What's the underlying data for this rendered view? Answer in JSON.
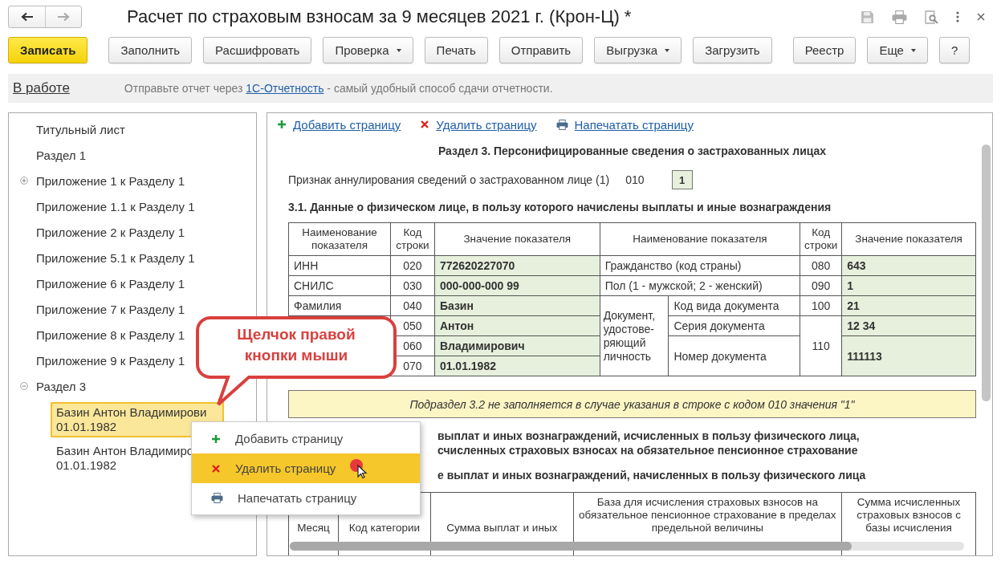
{
  "window": {
    "title": "Расчет по страховым взносам за 9 месяцев 2021 г. (Крон-Ц) *"
  },
  "toolbar": [
    {
      "label": "Записать",
      "kind": "primary"
    },
    {
      "label": "Заполнить",
      "kind": "plain"
    },
    {
      "label": "Расшифровать",
      "kind": "plain"
    },
    {
      "label": "Проверка",
      "kind": "dropdown"
    },
    {
      "label": "Печать",
      "kind": "plain"
    },
    {
      "label": "Отправить",
      "kind": "plain"
    },
    {
      "label": "Выгрузка",
      "kind": "dropdown"
    },
    {
      "label": "Загрузить",
      "kind": "plain"
    },
    {
      "label": "Реестр",
      "kind": "plain"
    },
    {
      "label": "Еще",
      "kind": "dropdown"
    },
    {
      "label": "?",
      "kind": "plain"
    }
  ],
  "info_bar": {
    "status": "В работе",
    "before": "Отправьте отчет через ",
    "link": "1С-Отчетность",
    "after": " - самый удобный способ сдачи отчетности."
  },
  "sidebar": {
    "items": [
      {
        "label": "Титульный лист",
        "selected": false
      },
      {
        "label": "Раздел 1",
        "selected": false
      },
      {
        "label": "Приложение 1 к Разделу 1",
        "selected": false,
        "expanded": false
      },
      {
        "label": "Приложение 1.1 к Разделу 1",
        "selected": false
      },
      {
        "label": "Приложение 2 к Разделу 1",
        "selected": false
      },
      {
        "label": "Приложение 5.1 к Разделу 1",
        "selected": false
      },
      {
        "label": "Приложение 6 к Разделу 1",
        "selected": false
      },
      {
        "label": "Приложение 7 к Разделу 1",
        "selected": false
      },
      {
        "label": "Приложение 8 к Разделу 1",
        "selected": false
      },
      {
        "label": "Приложение 9 к Разделу 1",
        "selected": false
      },
      {
        "label": "Раздел 3",
        "selected": false,
        "expanded": true,
        "children": [
          {
            "label": "Базин Антон Владимирови",
            "date": "01.01.1982",
            "selected": true
          },
          {
            "label": "Базин Антон Владимиро",
            "date": "01.01.1982",
            "selected": false
          }
        ]
      }
    ]
  },
  "page_actions": [
    {
      "label": "Добавить страницу",
      "kind": "add"
    },
    {
      "label": "Удалить страницу",
      "kind": "delete"
    },
    {
      "label": "Напечатать страницу",
      "kind": "print"
    }
  ],
  "form": {
    "title": "Раздел 3. Персонифицированные сведения о застрахованных лицах",
    "cancel_flag": {
      "label": "Признак аннулирования сведений о застрахованном лице (1)",
      "code": "010",
      "value": "1"
    },
    "subtitle": "3.1. Данные о физическом лице, в пользу которого начислены выплаты и иные вознаграждения",
    "person_table": {
      "columns": [
        "Наименование показателя",
        "Код строки",
        "Значение показателя",
        "Наименование показателя",
        "Код строки",
        "Значение показателя"
      ],
      "left_rows": [
        {
          "label": "ИНН",
          "code": "020",
          "value": "772620227070"
        },
        {
          "label": "СНИЛС",
          "code": "030",
          "value": "000-000-000 99"
        },
        {
          "label": "Фамилия",
          "code": "040",
          "value": "Базин"
        },
        {
          "code": "050",
          "value": "Антон"
        },
        {
          "code": "060",
          "value": "Владимирович"
        },
        {
          "code": "070",
          "value": "01.01.1982"
        }
      ],
      "right_rows": [
        {
          "label": "Гражданство (код страны)",
          "code": "080",
          "value": "643"
        },
        {
          "label": "Пол (1 - мужской; 2 - женский)",
          "code": "090",
          "value": "1"
        }
      ],
      "document": {
        "label": "Документ, удостове-ряющий личность",
        "type": {
          "label": "Код вида документа",
          "code": "100",
          "value": "21"
        },
        "series": {
          "label": "Серия документа",
          "value": "12 34"
        },
        "number": {
          "label": "Номер документа",
          "value": "111113"
        },
        "code": "110"
      }
    },
    "note": "Подраздел 3.2 не заполняется в случае указания в строке с кодом 010 значения \"1\"",
    "cut_headings": [
      [
        "выплат и иных вознаграждений, исчисленных в пользу физического лица,",
        "счисленных страховых взносах на обязательное пенсионное страхование"
      ],
      [
        "е выплат и иных вознаграждений, начисленных в пользу физического лица"
      ]
    ],
    "payments_table": {
      "columns": [
        "Месяц",
        "Код категории",
        "Сумма выплат и иных",
        "База для исчисления страховых взносов на обязательное пенсионное страхование в пределах предельной величины",
        "Сумма исчисленных страховых взносов с базы исчисления"
      ]
    }
  },
  "callout": "Щелчок правой кнопки мыши",
  "context_menu": [
    {
      "label": "Добавить страницу",
      "kind": "add",
      "selected": false
    },
    {
      "label": "Удалить страницу",
      "kind": "delete",
      "selected": true
    },
    {
      "label": "Напечатать страницу",
      "kind": "print",
      "selected": false
    }
  ]
}
